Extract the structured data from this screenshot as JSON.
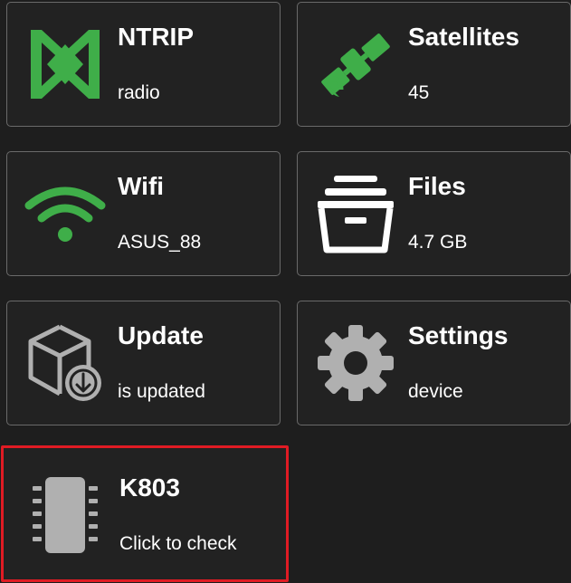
{
  "tiles": [
    {
      "title": "NTRIP",
      "subtitle": "radio",
      "icon": "ntrip-icon",
      "color": "#3fae49"
    },
    {
      "title": "Satellites",
      "subtitle": "45",
      "icon": "satellite-icon",
      "color": "#3fae49"
    },
    {
      "title": "Wifi",
      "subtitle": "ASUS_88",
      "icon": "wifi-icon",
      "color": "#3fae49"
    },
    {
      "title": "Files",
      "subtitle": "4.7 GB",
      "icon": "archive-box-icon",
      "color": "#ffffff"
    },
    {
      "title": "Update",
      "subtitle": "is updated",
      "icon": "package-update-icon",
      "color": "#b0b0b0"
    },
    {
      "title": "Settings",
      "subtitle": "device",
      "icon": "gear-icon",
      "color": "#b0b0b0"
    },
    {
      "title": "K803",
      "subtitle": "Click to check",
      "icon": "chip-icon",
      "color": "#b0b0b0"
    }
  ],
  "colors": {
    "background": "#1e1e1e",
    "tile_border": "#6a6a6a",
    "selected_border": "#e01b24",
    "accent_green": "#3fae49"
  }
}
